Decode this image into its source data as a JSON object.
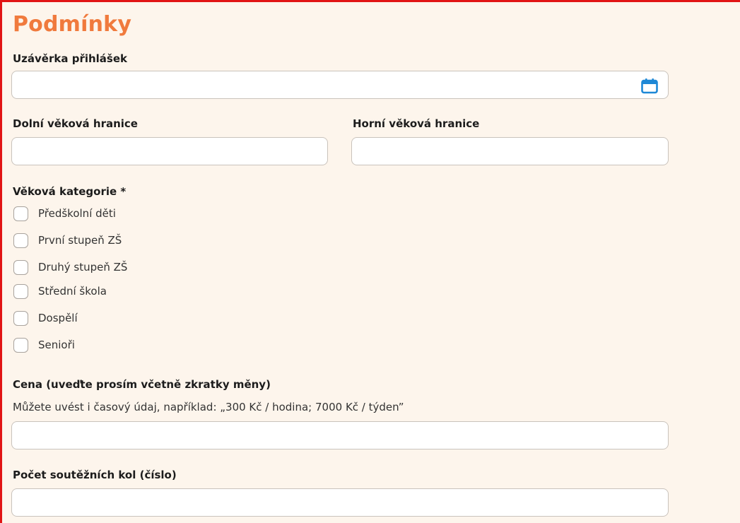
{
  "section": {
    "title": "Podmínky"
  },
  "deadline": {
    "label": "Uzávěrka přihlášek",
    "value": "",
    "icon": "calendar-icon",
    "icon_color": "#1e88d6"
  },
  "age_limits": {
    "lower_label": "Dolní věková hranice",
    "lower_value": "",
    "upper_label": "Horní věková hranice",
    "upper_value": ""
  },
  "age_category": {
    "label": "Věková kategorie *",
    "options": [
      {
        "label": "Předškolní děti",
        "checked": false
      },
      {
        "label": "První stupeň ZŠ",
        "checked": false
      },
      {
        "label": "Druhý stupeň ZŠ",
        "checked": false
      },
      {
        "label": "Střední škola",
        "checked": false
      },
      {
        "label": "Dospělí",
        "checked": false
      },
      {
        "label": "Senioři",
        "checked": false
      }
    ]
  },
  "price": {
    "label": "Cena (uveďte prosím včetně zkratky měny)",
    "hint": "Můžete uvést i časový údaj, například: „300 Kč / hodina; 7000 Kč / týden”",
    "value": ""
  },
  "rounds": {
    "label": "Počet soutěžních kol (číslo)",
    "value": ""
  },
  "colors": {
    "title": "#f07a3d",
    "frame_border": "#e11414",
    "background": "#fdf5ec"
  }
}
